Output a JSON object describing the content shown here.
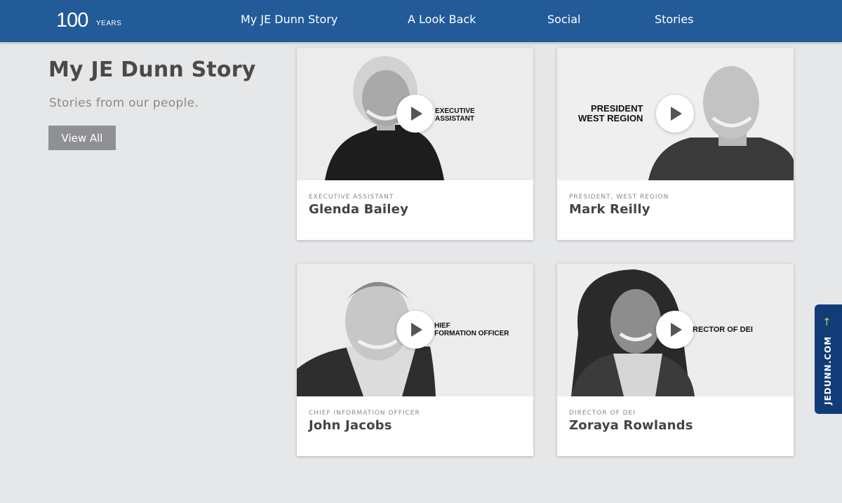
{
  "brand": {
    "logo_number": "100",
    "logo_word": "YEARS"
  },
  "nav": {
    "items": [
      {
        "label": "My JE Dunn Story"
      },
      {
        "label": "A Look Back"
      },
      {
        "label": "Social"
      },
      {
        "label": "Stories"
      }
    ]
  },
  "hero": {
    "title": "My JE Dunn Story",
    "subtitle": "Stories from our people.",
    "button_label": "View All"
  },
  "cards": [
    {
      "role": "Executive Assistant",
      "name": "Glenda Bailey",
      "overlay_line1": "EXECUTIVE",
      "overlay_line2": "ASSISTANT"
    },
    {
      "role": "President, West Region",
      "name": "Mark Reilly",
      "overlay_line1": "PRESIDENT",
      "overlay_line2": "WEST REGION"
    },
    {
      "role": "Chief Information Officer",
      "name": "John Jacobs",
      "overlay_line1": "HIEF",
      "overlay_line2": "FORMATION OFFICER"
    },
    {
      "role": "Director of DEI",
      "name": "Zoraya Rowlands",
      "overlay_line1": "RECTOR OF DEI",
      "overlay_line2": ""
    }
  ],
  "side_tab": {
    "label": "JEDUNN.COM",
    "icon": "arrow-up-icon"
  },
  "colors": {
    "nav": "#225b98",
    "side_tab": "#113c78",
    "button": "#8e9095",
    "page_bg": "#e6e7e9"
  }
}
